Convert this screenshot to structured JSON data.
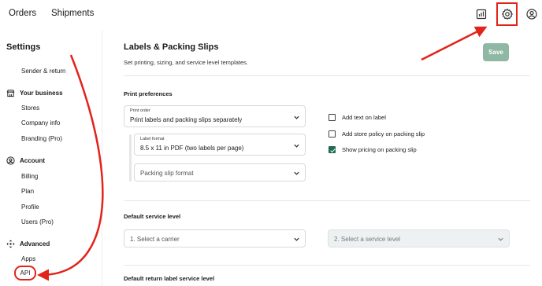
{
  "topbar": {
    "nav": [
      "Orders",
      "Shipments"
    ],
    "icons": [
      "bar-chart-icon",
      "gear-icon",
      "user-icon"
    ]
  },
  "sidebar": {
    "title": "Settings",
    "sender_return": "Sender & return",
    "sections": [
      {
        "label": "Your business",
        "icon": "store-icon",
        "items": [
          "Stores",
          "Company info",
          "Branding (Pro)"
        ]
      },
      {
        "label": "Account",
        "icon": "account-icon",
        "items": [
          "Billing",
          "Plan",
          "Profile",
          "Users (Pro)"
        ]
      },
      {
        "label": "Advanced",
        "icon": "move-icon",
        "items": [
          "Apps",
          "API"
        ]
      }
    ]
  },
  "main": {
    "title": "Labels & Packing Slips",
    "subtitle": "Set printing, sizing, and service level templates.",
    "save_label": "Save",
    "print_prefs": {
      "title": "Print preferences",
      "print_order_label": "Print order",
      "print_order_value": "Print labels and packing slips separately",
      "label_format_label": "Label format",
      "label_format_value": "8.5 x 11 in PDF (two labels per page)",
      "packing_slip_placeholder": "Packing slip format",
      "checkboxes": [
        {
          "label": "Add text on label",
          "checked": false
        },
        {
          "label": "Add store policy on packing slip",
          "checked": false
        },
        {
          "label": "Show pricing on packing slip",
          "checked": true
        }
      ]
    },
    "default_service": {
      "title": "Default service level",
      "carrier_placeholder": "1. Select a carrier",
      "service_placeholder": "2. Select a service level"
    },
    "return_service": {
      "title": "Default return label service level"
    }
  },
  "colors": {
    "accent_green": "#1f6b52",
    "save_button": "#8fb8a4",
    "annotation_red": "#e2231a"
  }
}
